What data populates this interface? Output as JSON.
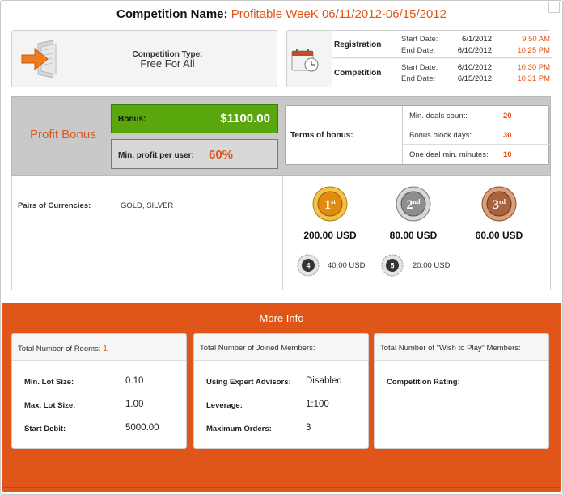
{
  "header": {
    "label": "Competition Name:",
    "name": "Profitable WeeK 06/11/2012-06/15/2012"
  },
  "competition_type": {
    "label": "Competition Type:",
    "value": "Free For All"
  },
  "dates": {
    "registration": {
      "name": "Registration",
      "start_label": "Start Date:",
      "start_date": "6/1/2012",
      "start_time": "9:50 AM",
      "end_label": "End Date:",
      "end_date": "6/10/2012",
      "end_time": "10:25 PM"
    },
    "competition": {
      "name": "Competition",
      "start_label": "Start Date:",
      "start_date": "6/10/2012",
      "start_time": "10:30 PM",
      "end_label": "End Date:",
      "end_date": "6/15/2012",
      "end_time": "10:31 PM"
    }
  },
  "bonus": {
    "section_label": "Profit Bonus",
    "bonus_label": "Bonus:",
    "bonus_value": "$1100.00",
    "min_profit_label": "Min. profit per user:",
    "min_profit_value": "60%",
    "terms_label": "Terms of bonus:",
    "terms": [
      {
        "name": "Min. deals count:",
        "value": "20"
      },
      {
        "name": "Bonus block days:",
        "value": "30"
      },
      {
        "name": "One deal min. minutes:",
        "value": "10"
      }
    ]
  },
  "pairs": {
    "label": "Pairs of Currencies:",
    "value": "GOLD, SILVER"
  },
  "prizes": {
    "top": [
      {
        "rank": "1",
        "suffix": "st",
        "amount": "200.00 USD",
        "color": "#e3a21a"
      },
      {
        "rank": "2",
        "suffix": "nd",
        "amount": "80.00 USD",
        "color": "#9a9a9a"
      },
      {
        "rank": "3",
        "suffix": "rd",
        "amount": "60.00 USD",
        "color": "#b0704a"
      }
    ],
    "small": [
      {
        "rank": "4",
        "amount": "40.00 USD"
      },
      {
        "rank": "5",
        "amount": "20.00 USD"
      }
    ]
  },
  "more_info": {
    "title": "More Info",
    "rooms": {
      "label": "Total Number of Rooms:",
      "value": "1",
      "rows": [
        {
          "k": "Min. Lot Size:",
          "v": "0.10"
        },
        {
          "k": "Max. Lot Size:",
          "v": "1.00"
        },
        {
          "k": "Start Debit:",
          "v": "5000.00"
        }
      ]
    },
    "members": {
      "label": "Total Number of Joined Members:",
      "rows": [
        {
          "k": "Using Expert Advisors:",
          "v": "Disabled"
        },
        {
          "k": "Leverage:",
          "v": "1:100"
        },
        {
          "k": "Maximum Orders:",
          "v": "3"
        }
      ]
    },
    "wish": {
      "label": "Total Number of “Wish to Play” Members:",
      "rating_label": "Competition Rating:"
    }
  },
  "colors": {
    "accent": "#e0561a",
    "bonus_green": "#5aa60d"
  }
}
